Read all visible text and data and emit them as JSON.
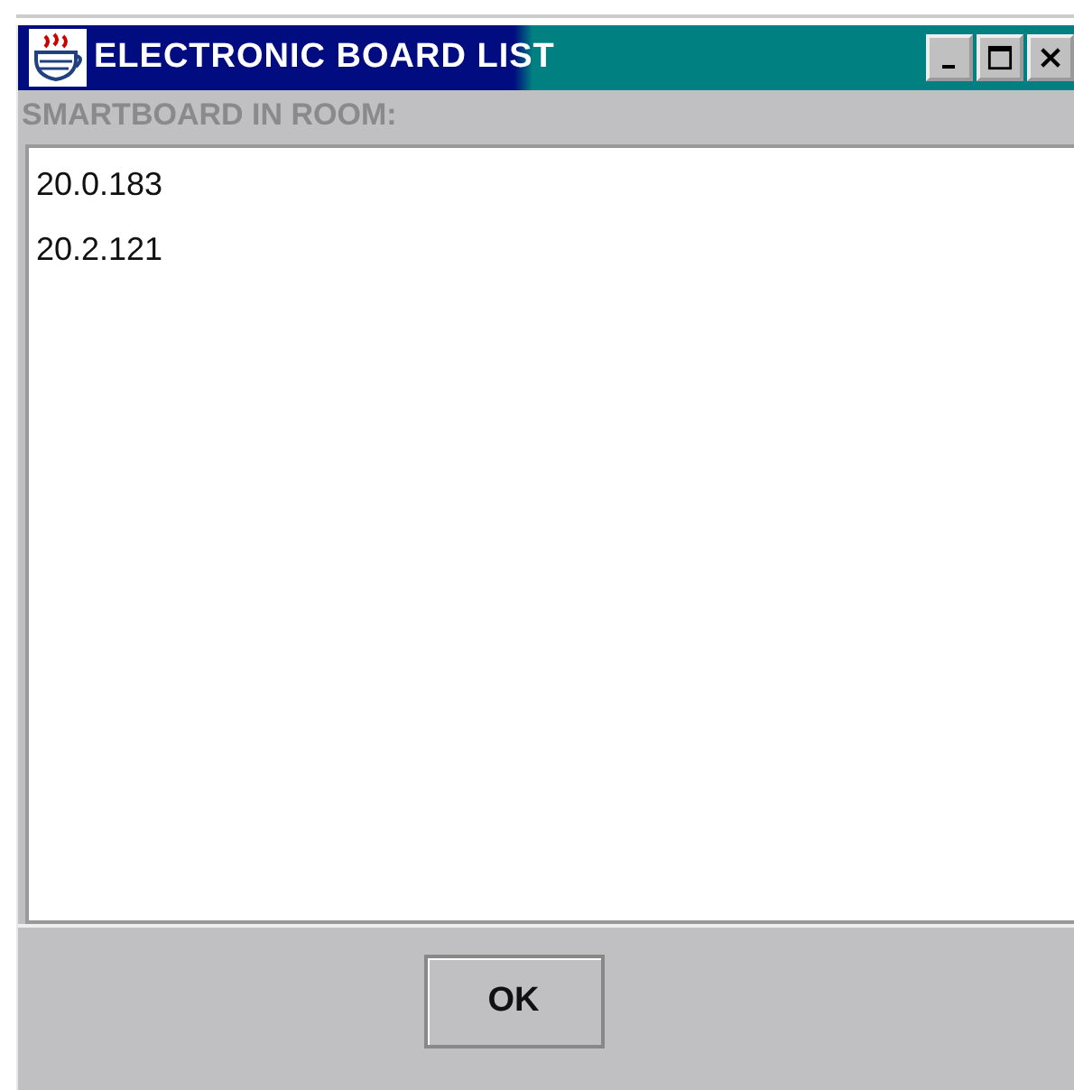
{
  "window": {
    "title": "ELECTRONIC BOARD LIST"
  },
  "label": "SMARTBOARD IN ROOM:",
  "list": {
    "items": [
      {
        "text": "20.0.183",
        "selected": false
      },
      {
        "text": "20.2.121",
        "selected": false
      }
    ]
  },
  "buttons": [
    "OK"
  ]
}
